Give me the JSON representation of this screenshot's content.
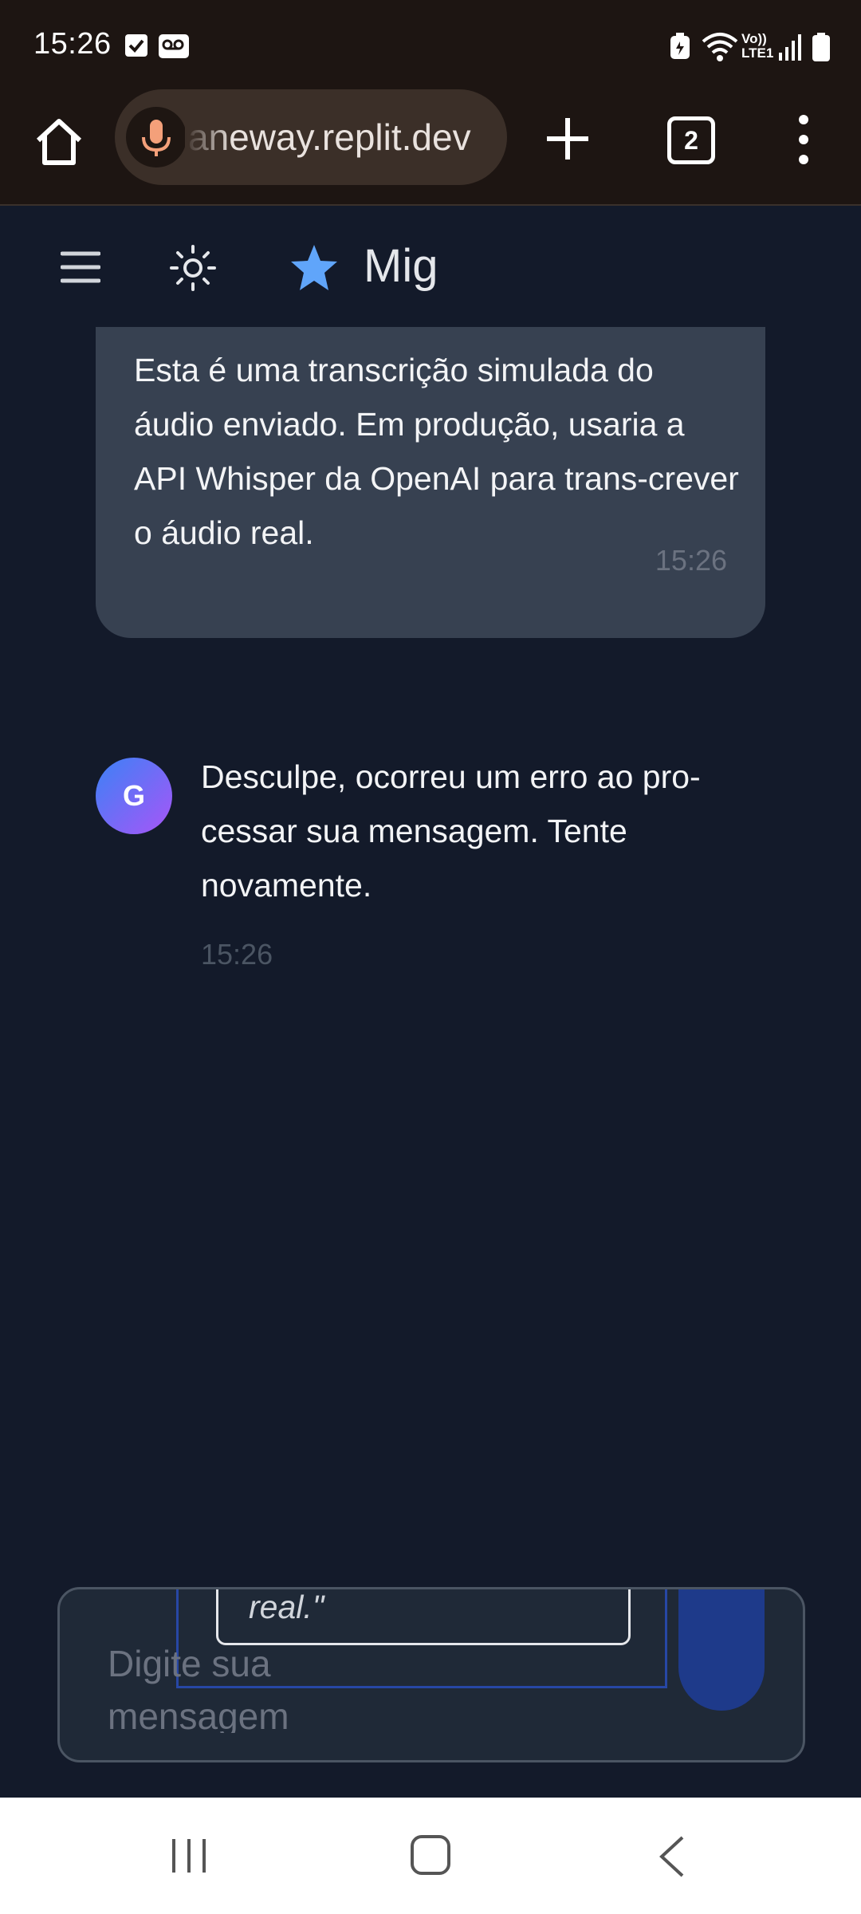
{
  "status_bar": {
    "time": "15:26",
    "icons": [
      "checkbox-notification-icon",
      "voicemail-icon",
      "battery-saver-icon",
      "wifi-icon",
      "volte-icon",
      "signal-icon",
      "battery-icon"
    ],
    "volte_label_top": "Vo))",
    "volte_label_bottom": "LTE1"
  },
  "browser": {
    "url": "aneway.replit.dev",
    "tab_count": "2",
    "mic_color": "#f4a07a"
  },
  "app": {
    "title": "Mig",
    "accent": "#60a5fa"
  },
  "messages": [
    {
      "role": "user",
      "text": "Esta é uma transcrição simulada do áudio enviado. Em produção, usaria a API Whisper da OpenAI para trans-crever o áudio real.",
      "time": "15:26"
    },
    {
      "role": "assistant",
      "avatar_letter": "G",
      "text": "Desculpe, ocorreu um erro ao pro-cessar sua mensagem. Tente novamente.",
      "time": "15:26"
    }
  ],
  "composer": {
    "placeholder": "Digite sua mensagem",
    "overlay_snippet": "real.\""
  }
}
